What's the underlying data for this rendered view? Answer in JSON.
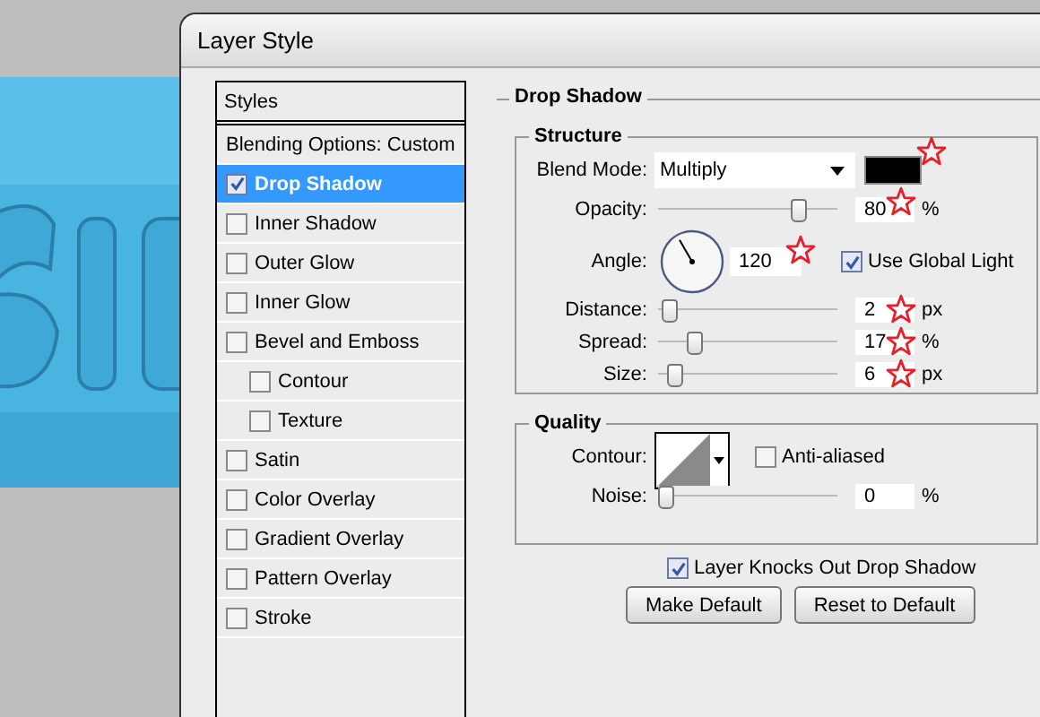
{
  "window": {
    "title": "Layer Style"
  },
  "styles_panel": {
    "header": "Styles",
    "items": [
      {
        "label": "Blending Options: Custom",
        "kind": "plain",
        "selected": false
      },
      {
        "label": "Drop Shadow",
        "kind": "checkbox",
        "checked": true,
        "selected": true
      },
      {
        "label": "Inner Shadow",
        "kind": "checkbox",
        "checked": false,
        "selected": false
      },
      {
        "label": "Outer Glow",
        "kind": "checkbox",
        "checked": false,
        "selected": false
      },
      {
        "label": "Inner Glow",
        "kind": "checkbox",
        "checked": false,
        "selected": false
      },
      {
        "label": "Bevel and Emboss",
        "kind": "checkbox",
        "checked": false,
        "selected": false,
        "children": [
          {
            "label": "Contour",
            "kind": "checkbox",
            "checked": false,
            "selected": false
          },
          {
            "label": "Texture",
            "kind": "checkbox",
            "checked": false,
            "selected": false
          }
        ]
      },
      {
        "label": "Satin",
        "kind": "checkbox",
        "checked": false,
        "selected": false
      },
      {
        "label": "Color Overlay",
        "kind": "checkbox",
        "checked": false,
        "selected": false
      },
      {
        "label": "Gradient Overlay",
        "kind": "checkbox",
        "checked": false,
        "selected": false
      },
      {
        "label": "Pattern Overlay",
        "kind": "checkbox",
        "checked": false,
        "selected": false
      },
      {
        "label": "Stroke",
        "kind": "checkbox",
        "checked": false,
        "selected": false
      }
    ]
  },
  "section": {
    "title": "Drop Shadow",
    "structure": {
      "title": "Structure",
      "blend_mode": {
        "label": "Blend Mode:",
        "value": "Multiply",
        "color": "#000000"
      },
      "opacity": {
        "label": "Opacity:",
        "value": "80",
        "unit": "%",
        "level": 0.8
      },
      "angle": {
        "label": "Angle:",
        "value": "120"
      },
      "use_global_light": {
        "label": "Use Global Light",
        "checked": true
      },
      "distance": {
        "label": "Distance:",
        "value": "2",
        "unit": "px",
        "level": 0.02
      },
      "spread": {
        "label": "Spread:",
        "value": "17",
        "unit": "%",
        "level": 0.17
      },
      "size": {
        "label": "Size:",
        "value": "6",
        "unit": "px",
        "level": 0.05
      }
    },
    "quality": {
      "title": "Quality",
      "contour": {
        "label": "Contour:"
      },
      "anti_aliased": {
        "label": "Anti-aliased",
        "checked": false
      },
      "noise": {
        "label": "Noise:",
        "value": "0",
        "unit": "%",
        "level": 0
      }
    },
    "layer_knocks_out": {
      "label": "Layer Knocks Out Drop Shadow",
      "checked": true
    },
    "buttons": [
      "Make Default",
      "Reset to Default"
    ]
  }
}
